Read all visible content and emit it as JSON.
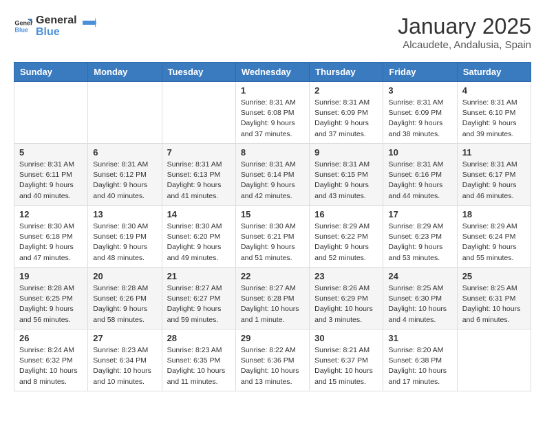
{
  "logo": {
    "general": "General",
    "blue": "Blue"
  },
  "title": "January 2025",
  "location": "Alcaudete, Andalusia, Spain",
  "headers": [
    "Sunday",
    "Monday",
    "Tuesday",
    "Wednesday",
    "Thursday",
    "Friday",
    "Saturday"
  ],
  "rows": [
    [
      {
        "day": "",
        "info": ""
      },
      {
        "day": "",
        "info": ""
      },
      {
        "day": "",
        "info": ""
      },
      {
        "day": "1",
        "info": "Sunrise: 8:31 AM\nSunset: 6:08 PM\nDaylight: 9 hours\nand 37 minutes."
      },
      {
        "day": "2",
        "info": "Sunrise: 8:31 AM\nSunset: 6:09 PM\nDaylight: 9 hours\nand 37 minutes."
      },
      {
        "day": "3",
        "info": "Sunrise: 8:31 AM\nSunset: 6:09 PM\nDaylight: 9 hours\nand 38 minutes."
      },
      {
        "day": "4",
        "info": "Sunrise: 8:31 AM\nSunset: 6:10 PM\nDaylight: 9 hours\nand 39 minutes."
      }
    ],
    [
      {
        "day": "5",
        "info": "Sunrise: 8:31 AM\nSunset: 6:11 PM\nDaylight: 9 hours\nand 40 minutes."
      },
      {
        "day": "6",
        "info": "Sunrise: 8:31 AM\nSunset: 6:12 PM\nDaylight: 9 hours\nand 40 minutes."
      },
      {
        "day": "7",
        "info": "Sunrise: 8:31 AM\nSunset: 6:13 PM\nDaylight: 9 hours\nand 41 minutes."
      },
      {
        "day": "8",
        "info": "Sunrise: 8:31 AM\nSunset: 6:14 PM\nDaylight: 9 hours\nand 42 minutes."
      },
      {
        "day": "9",
        "info": "Sunrise: 8:31 AM\nSunset: 6:15 PM\nDaylight: 9 hours\nand 43 minutes."
      },
      {
        "day": "10",
        "info": "Sunrise: 8:31 AM\nSunset: 6:16 PM\nDaylight: 9 hours\nand 44 minutes."
      },
      {
        "day": "11",
        "info": "Sunrise: 8:31 AM\nSunset: 6:17 PM\nDaylight: 9 hours\nand 46 minutes."
      }
    ],
    [
      {
        "day": "12",
        "info": "Sunrise: 8:30 AM\nSunset: 6:18 PM\nDaylight: 9 hours\nand 47 minutes."
      },
      {
        "day": "13",
        "info": "Sunrise: 8:30 AM\nSunset: 6:19 PM\nDaylight: 9 hours\nand 48 minutes."
      },
      {
        "day": "14",
        "info": "Sunrise: 8:30 AM\nSunset: 6:20 PM\nDaylight: 9 hours\nand 49 minutes."
      },
      {
        "day": "15",
        "info": "Sunrise: 8:30 AM\nSunset: 6:21 PM\nDaylight: 9 hours\nand 51 minutes."
      },
      {
        "day": "16",
        "info": "Sunrise: 8:29 AM\nSunset: 6:22 PM\nDaylight: 9 hours\nand 52 minutes."
      },
      {
        "day": "17",
        "info": "Sunrise: 8:29 AM\nSunset: 6:23 PM\nDaylight: 9 hours\nand 53 minutes."
      },
      {
        "day": "18",
        "info": "Sunrise: 8:29 AM\nSunset: 6:24 PM\nDaylight: 9 hours\nand 55 minutes."
      }
    ],
    [
      {
        "day": "19",
        "info": "Sunrise: 8:28 AM\nSunset: 6:25 PM\nDaylight: 9 hours\nand 56 minutes."
      },
      {
        "day": "20",
        "info": "Sunrise: 8:28 AM\nSunset: 6:26 PM\nDaylight: 9 hours\nand 58 minutes."
      },
      {
        "day": "21",
        "info": "Sunrise: 8:27 AM\nSunset: 6:27 PM\nDaylight: 9 hours\nand 59 minutes."
      },
      {
        "day": "22",
        "info": "Sunrise: 8:27 AM\nSunset: 6:28 PM\nDaylight: 10 hours\nand 1 minute."
      },
      {
        "day": "23",
        "info": "Sunrise: 8:26 AM\nSunset: 6:29 PM\nDaylight: 10 hours\nand 3 minutes."
      },
      {
        "day": "24",
        "info": "Sunrise: 8:25 AM\nSunset: 6:30 PM\nDaylight: 10 hours\nand 4 minutes."
      },
      {
        "day": "25",
        "info": "Sunrise: 8:25 AM\nSunset: 6:31 PM\nDaylight: 10 hours\nand 6 minutes."
      }
    ],
    [
      {
        "day": "26",
        "info": "Sunrise: 8:24 AM\nSunset: 6:32 PM\nDaylight: 10 hours\nand 8 minutes."
      },
      {
        "day": "27",
        "info": "Sunrise: 8:23 AM\nSunset: 6:34 PM\nDaylight: 10 hours\nand 10 minutes."
      },
      {
        "day": "28",
        "info": "Sunrise: 8:23 AM\nSunset: 6:35 PM\nDaylight: 10 hours\nand 11 minutes."
      },
      {
        "day": "29",
        "info": "Sunrise: 8:22 AM\nSunset: 6:36 PM\nDaylight: 10 hours\nand 13 minutes."
      },
      {
        "day": "30",
        "info": "Sunrise: 8:21 AM\nSunset: 6:37 PM\nDaylight: 10 hours\nand 15 minutes."
      },
      {
        "day": "31",
        "info": "Sunrise: 8:20 AM\nSunset: 6:38 PM\nDaylight: 10 hours\nand 17 minutes."
      },
      {
        "day": "",
        "info": ""
      }
    ]
  ]
}
